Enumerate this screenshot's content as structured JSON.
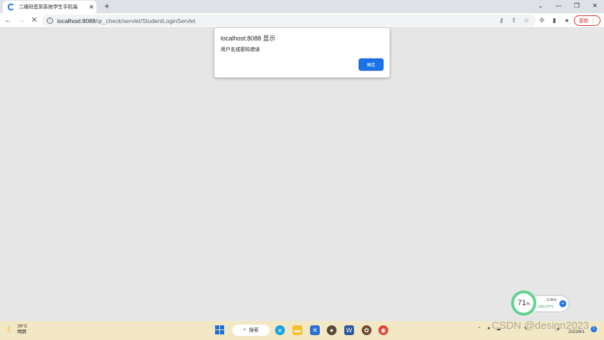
{
  "browser": {
    "tab": {
      "title": "二维码签到系统学生手机端",
      "close_glyph": "✕"
    },
    "new_tab_glyph": "+",
    "window": {
      "chevron": "⌄",
      "minimize": "—",
      "restore": "❐",
      "close": "✕"
    },
    "toolbar": {
      "back_glyph": "←",
      "forward_glyph": "→",
      "stop_glyph": "✕",
      "url_host": "localhost:8088",
      "url_path": "/qr_check/servlet/StudentLoginServlet",
      "update_label": "更新",
      "update_menu_glyph": "⋮"
    }
  },
  "dialog": {
    "title": "localhost:8088 显示",
    "message": "用户名或密码错误",
    "ok_label": "确定"
  },
  "monitor": {
    "percent": "71",
    "percent_unit": "%",
    "speed": "0.3K/s",
    "cpu": "CPU 67°C"
  },
  "taskbar": {
    "weather_temp": "26°C",
    "weather_desc": "晴朗",
    "search_label": "搜索",
    "date": "2023/6/1",
    "notification_count": "1"
  },
  "watermark": "CSDN @design2023",
  "colors": {
    "accent": "#1a73e8",
    "taskbar": "#f3e8c6",
    "page_bg": "#e6e6e6",
    "update_red": "#d93025"
  }
}
